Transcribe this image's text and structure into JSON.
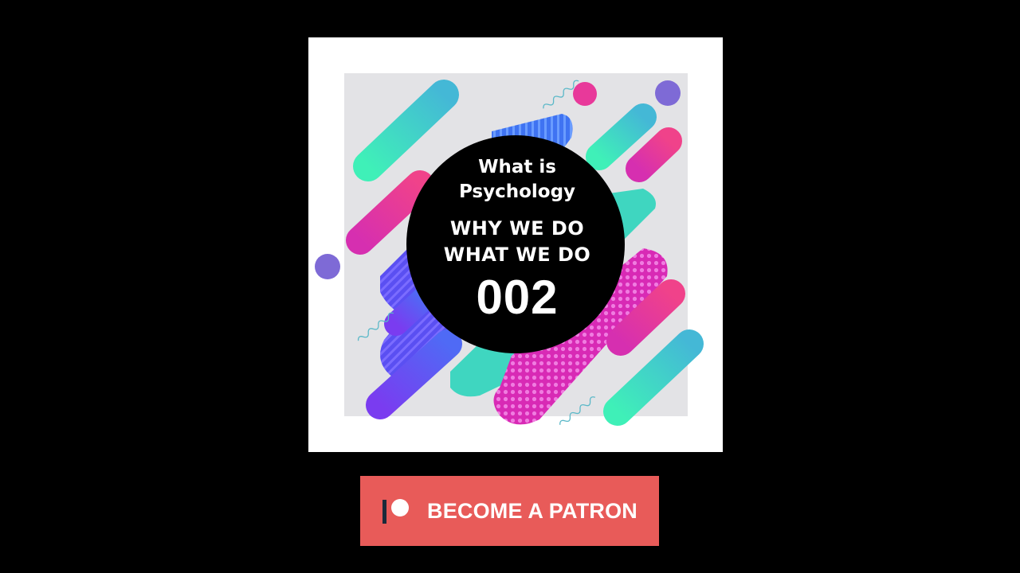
{
  "cover": {
    "title_line1": "What is",
    "title_line2": "Psychology",
    "subtitle_line1": "WHY WE DO",
    "subtitle_line2": "WHAT WE DO",
    "episode_number": "002"
  },
  "patron_button": {
    "label": "BECOME A PATRON",
    "icon": "patreon-logo-icon",
    "color": "#e85b59"
  },
  "colors": {
    "background": "#000000",
    "teal": "#3fd6c0",
    "pink": "#e8399a",
    "purple": "#6a4cf0",
    "blue": "#4d7ff5"
  }
}
